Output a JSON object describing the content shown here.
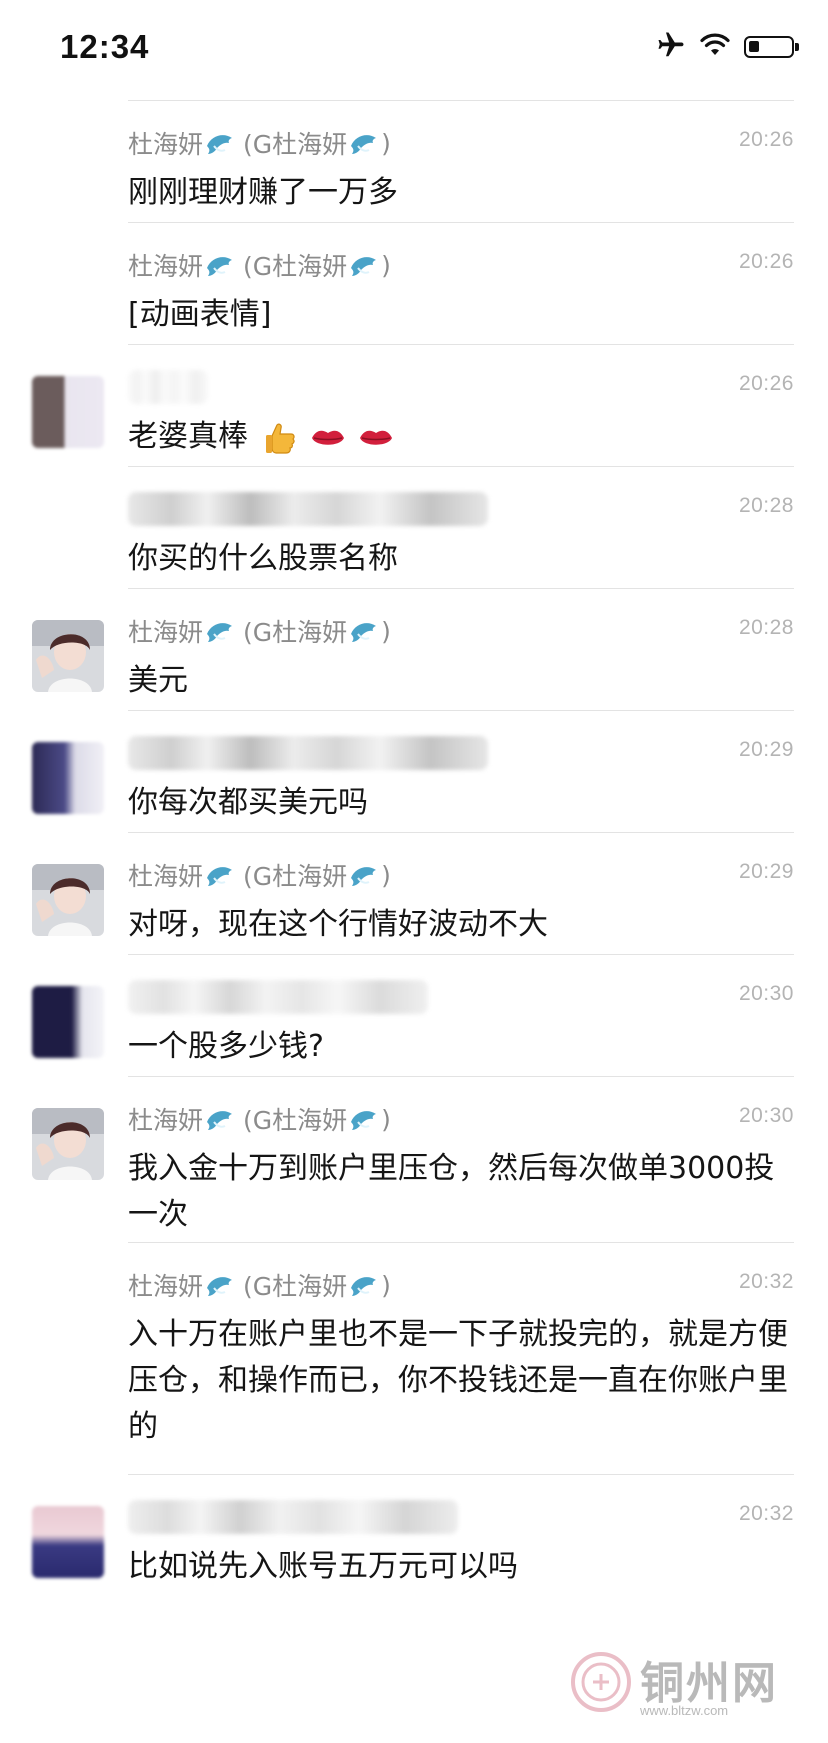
{
  "status_bar": {
    "time": "12:34"
  },
  "messages": [
    {
      "sender_name": "杜海妍",
      "sender_alias_prefix": "(G杜海妍",
      "sender_alias_suffix": ")",
      "time": "20:26",
      "text": "刚刚理财赚了一万多"
    },
    {
      "sender_name": "杜海妍",
      "sender_alias_prefix": "(G杜海妍",
      "sender_alias_suffix": ")",
      "time": "20:26",
      "text": "[动画表情]"
    },
    {
      "time": "20:26",
      "text": "老婆真棒"
    },
    {
      "time": "20:28",
      "text": "你买的什么股票名称"
    },
    {
      "sender_name": "杜海妍",
      "sender_alias_prefix": "(G杜海妍",
      "sender_alias_suffix": ")",
      "time": "20:28",
      "text": "美元"
    },
    {
      "time": "20:29",
      "text": "你每次都买美元吗"
    },
    {
      "sender_name": "杜海妍",
      "sender_alias_prefix": "(G杜海妍",
      "sender_alias_suffix": ")",
      "time": "20:29",
      "text": "对呀，现在这个行情好波动不大"
    },
    {
      "time": "20:30",
      "text": "一个股多少钱?"
    },
    {
      "sender_name": "杜海妍",
      "sender_alias_prefix": "(G杜海妍",
      "sender_alias_suffix": ")",
      "time": "20:30",
      "text": "我入金十万到账户里压仓，然后每次做单3000投一次"
    },
    {
      "sender_name": "杜海妍",
      "sender_alias_prefix": "(G杜海妍",
      "sender_alias_suffix": ")",
      "time": "20:32",
      "text": "入十万在账户里也不是一下子就投完的，就是方便压仓，和操作而已，你不投钱还是一直在你账户里的"
    },
    {
      "time": "20:32",
      "text": "比如说先入账号五万元可以吗"
    }
  ],
  "icons": {
    "status": [
      "airplane-icon",
      "wifi-icon",
      "battery-icon"
    ],
    "sender_badge": "dolphin-icon",
    "reactions": [
      "thumbs-up-icon",
      "lips-icon",
      "lips-icon"
    ]
  },
  "watermark": {
    "name": "铜州网",
    "url": "www.bltzw.com"
  }
}
